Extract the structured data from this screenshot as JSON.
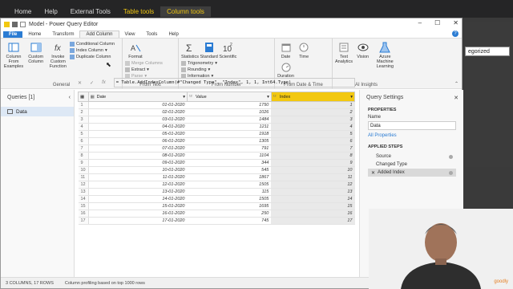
{
  "pbi": {
    "tabs": [
      "Home",
      "Help",
      "External Tools",
      "Table tools",
      "Column tools"
    ],
    "dropdown": "egorized"
  },
  "window": {
    "title": "Model - Power Query Editor",
    "controls": [
      "–",
      "☐",
      "✕"
    ]
  },
  "menu": {
    "items": [
      "File",
      "Home",
      "Transform",
      "Add Column",
      "View",
      "Tools",
      "Help"
    ],
    "active": "Add Column"
  },
  "ribbon": {
    "general": {
      "label": "General",
      "buttons": [
        "Column From Examples",
        "Custom Column",
        "Invoke Custom Function"
      ],
      "small": [
        "Conditional Column",
        "Index Column",
        "Duplicate Column"
      ]
    },
    "from_text": {
      "label": "From Text",
      "buttons": [
        "Format"
      ],
      "small": [
        "Merge Columns",
        "Extract",
        "Parse"
      ]
    },
    "from_number": {
      "label": "From Number",
      "buttons": [
        "Statistics",
        "Standard",
        "Scientific"
      ],
      "small": [
        "Trigonometry",
        "Rounding",
        "Information"
      ]
    },
    "from_date": {
      "label": "From Date & Time",
      "buttons": [
        "Date",
        "Time",
        "Duration"
      ]
    },
    "ai": {
      "label": "AI Insights",
      "buttons": [
        "Text Analytics",
        "Vision",
        "Azure Machine Learning"
      ]
    }
  },
  "queries": {
    "header": "Queries [1]",
    "items": [
      "Data"
    ]
  },
  "formula": "= Table.AddIndexColumn(#\"Changed Type\", \"Index\", 1, 1, Int64.Type)",
  "table": {
    "columns": [
      "Date",
      "Value",
      "Index"
    ],
    "rows": [
      [
        "01-01-2020",
        "1750",
        "1"
      ],
      [
        "02-01-2020",
        "1026",
        "2"
      ],
      [
        "03-01-2020",
        "1484",
        "3"
      ],
      [
        "04-01-2020",
        "1211",
        "4"
      ],
      [
        "05-01-2020",
        "1918",
        "5"
      ],
      [
        "06-01-2020",
        "1305",
        "6"
      ],
      [
        "07-01-2020",
        "791",
        "7"
      ],
      [
        "08-01-2020",
        "1104",
        "8"
      ],
      [
        "09-01-2020",
        "344",
        "9"
      ],
      [
        "10-01-2020",
        "545",
        "10"
      ],
      [
        "11-01-2020",
        "1867",
        "11"
      ],
      [
        "12-01-2020",
        "1505",
        "12"
      ],
      [
        "13-01-2020",
        "115",
        "13"
      ],
      [
        "14-01-2020",
        "1505",
        "14"
      ],
      [
        "15-01-2020",
        "1695",
        "15"
      ],
      [
        "16-01-2020",
        "250",
        "16"
      ],
      [
        "17-01-2020",
        "745",
        "17"
      ]
    ]
  },
  "settings": {
    "header": "Query Settings",
    "properties": "PROPERTIES",
    "name_label": "Name",
    "name_value": "Data",
    "all_props": "All Properties",
    "applied": "APPLIED STEPS",
    "steps": [
      "Source",
      "Changed Type",
      "Added Index"
    ]
  },
  "status": {
    "left": "3 COLUMNS, 17 ROWS",
    "right": "Column profiling based on top 1000 rows"
  },
  "brand": "goodly"
}
